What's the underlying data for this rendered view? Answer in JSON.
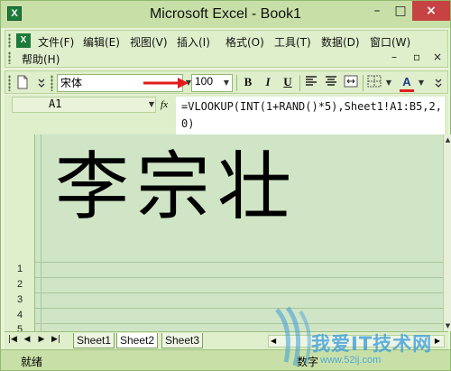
{
  "window": {
    "title": "Microsoft Excel - Book1",
    "app_icon": "X",
    "controls": {
      "minimize": "–",
      "maximize": "□",
      "close": "×"
    }
  },
  "menu": {
    "icon": "X",
    "items": [
      "文件(F)",
      "编辑(E)",
      "视图(V)",
      "插入(I)",
      "格式(O)",
      "工具(T)",
      "数据(D)",
      "窗口(W)",
      "帮助(H)"
    ],
    "doc_controls": {
      "minimize": "–",
      "restore": "▫",
      "close": "×"
    }
  },
  "toolbar": {
    "font_name": "宋体",
    "font_size": "100",
    "bold": "B",
    "italic": "I",
    "underline": "U",
    "font_color": "A",
    "font_color_hex": "#e02020",
    "annotation_arrow_color": "#e21b1b"
  },
  "formula_bar": {
    "name_box": "A1",
    "fx": "fx",
    "formula": "=VLOOKUP(INT(1+RAND()*5),Sheet1!A1:B5,2,0)"
  },
  "grid": {
    "cell_text": "李宗壮",
    "row_numbers": [
      "1",
      "2",
      "3",
      "4",
      "5"
    ]
  },
  "sheets": {
    "tabs": [
      "Sheet1",
      "Sheet2",
      "Sheet3"
    ],
    "active": "Sheet2"
  },
  "status": {
    "left": "就绪",
    "mode": "数字"
  },
  "watermark": {
    "text": "我爱IT技术网",
    "url": "www.52ij.com",
    "color": "#3d9dd9"
  }
}
